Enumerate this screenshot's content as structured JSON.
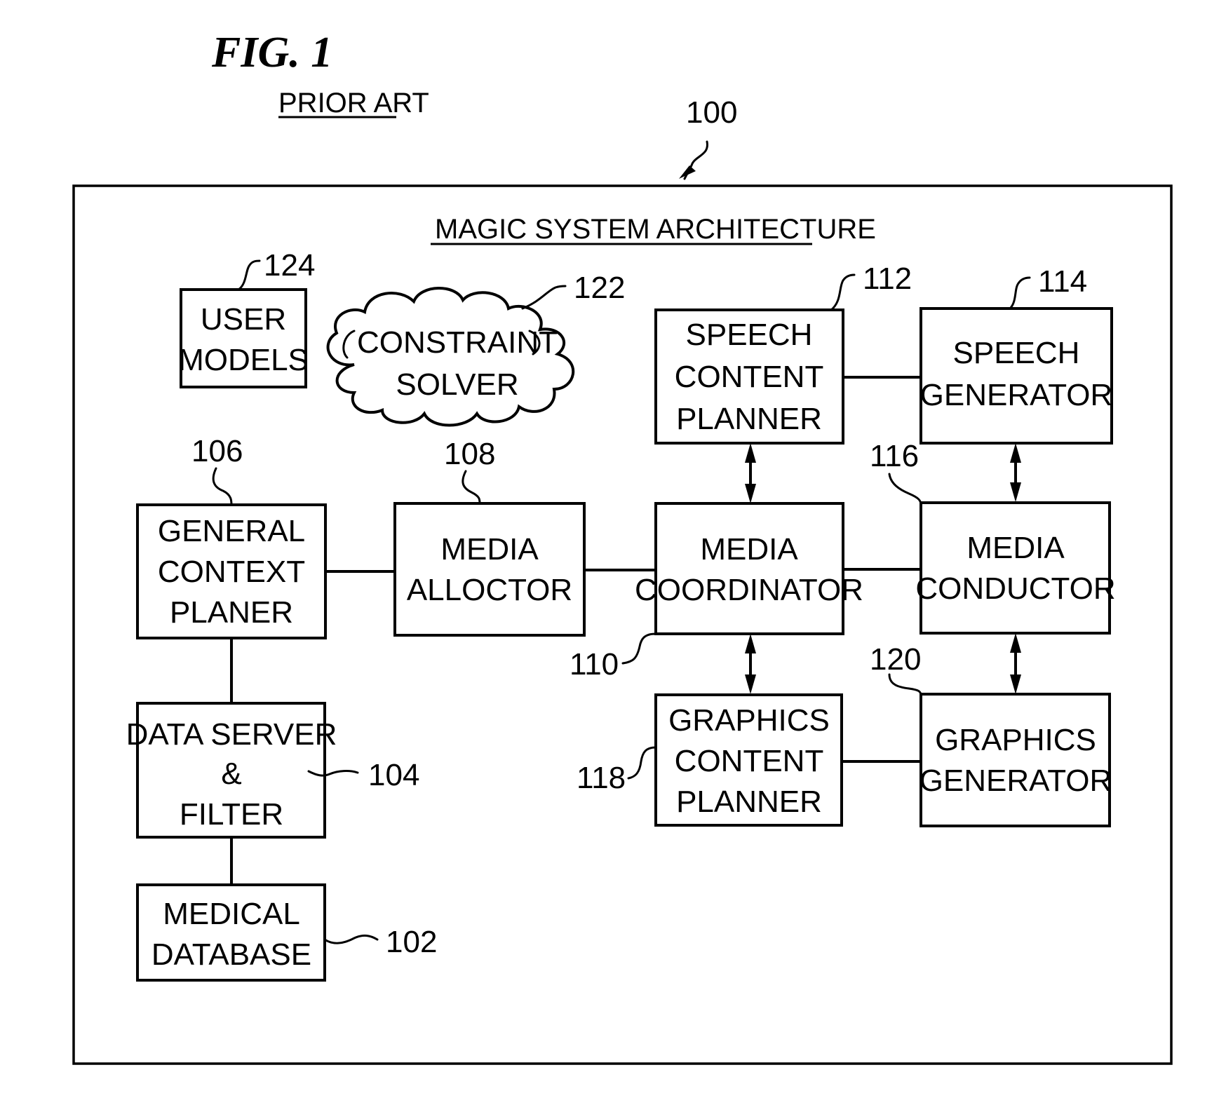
{
  "figure": {
    "label": "FIG. 1",
    "subtitle": "PRIOR ART",
    "ref": "100",
    "title": "MAGIC SYSTEM ARCHITECTURE"
  },
  "blocks": {
    "user_models": {
      "lines": [
        "USER",
        "MODELS"
      ],
      "ref": "124"
    },
    "constraint_solver": {
      "lines": [
        "CONSTRAINT",
        "SOLVER"
      ],
      "ref": "122"
    },
    "speech_content_planner": {
      "lines": [
        "SPEECH",
        "CONTENT",
        "PLANNER"
      ],
      "ref": "112"
    },
    "speech_generator": {
      "lines": [
        "SPEECH",
        "GENERATOR"
      ],
      "ref": "114"
    },
    "general_context_planer": {
      "lines": [
        "GENERAL",
        "CONTEXT",
        "PLANER"
      ],
      "ref": "106"
    },
    "media_allocator": {
      "lines": [
        "MEDIA",
        "ALLOCTOR"
      ],
      "ref": "108"
    },
    "media_coordinator": {
      "lines": [
        "MEDIA",
        "COORDINATOR"
      ],
      "ref": "110"
    },
    "media_conductor": {
      "lines": [
        "MEDIA",
        "CONDUCTOR"
      ],
      "ref": "116"
    },
    "data_server": {
      "lines": [
        "DATA  SERVER",
        "&",
        "FILTER"
      ],
      "ref": "104"
    },
    "graphics_content_planner": {
      "lines": [
        "GRAPHICS",
        "CONTENT",
        "PLANNER"
      ],
      "ref": "118"
    },
    "graphics_generator": {
      "lines": [
        "GRAPHICS",
        "GENERATOR"
      ],
      "ref": "120"
    },
    "medical_database": {
      "lines": [
        "MEDICAL",
        "DATABASE"
      ],
      "ref": "102"
    }
  }
}
